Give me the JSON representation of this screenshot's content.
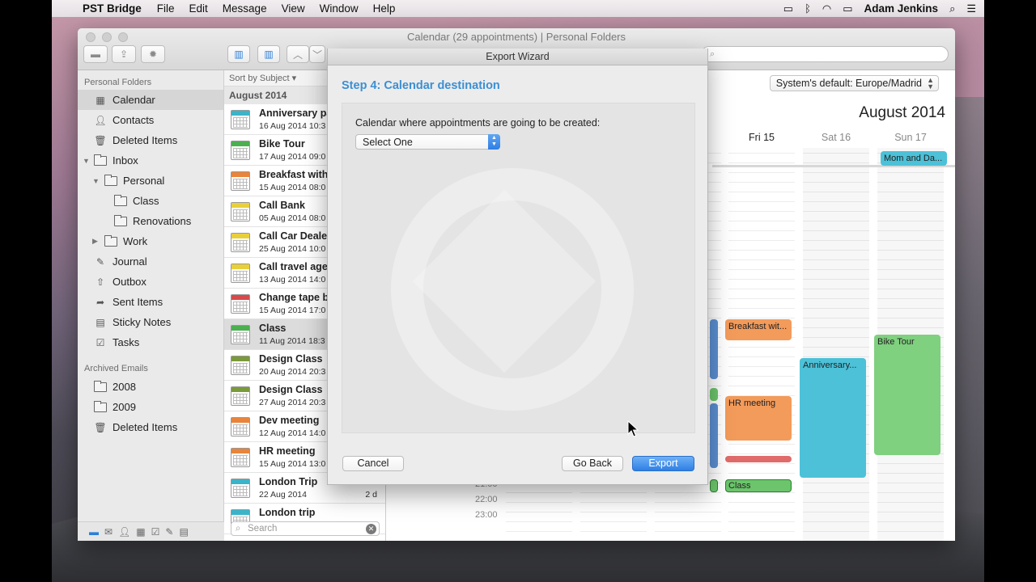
{
  "menubar": {
    "app_name": "PST Bridge",
    "items": [
      "File",
      "Edit",
      "Message",
      "View",
      "Window",
      "Help"
    ],
    "user": "Adam Jenkins"
  },
  "window": {
    "title": "Calendar (29 appointments) | Personal Folders",
    "search_placeholder": ""
  },
  "sidebar": {
    "section_personal": "Personal Folders",
    "items": [
      {
        "label": "Calendar",
        "icon": "calendar-icon"
      },
      {
        "label": "Contacts",
        "icon": "contacts-icon"
      },
      {
        "label": "Deleted Items",
        "icon": "trash-icon"
      },
      {
        "label": "Inbox",
        "icon": "folder-icon"
      },
      {
        "label": "Personal",
        "icon": "folder-icon"
      },
      {
        "label": "Class",
        "icon": "folder-icon"
      },
      {
        "label": "Renovations",
        "icon": "folder-icon"
      },
      {
        "label": "Work",
        "icon": "folder-icon"
      },
      {
        "label": "Journal",
        "icon": "journal-icon"
      },
      {
        "label": "Outbox",
        "icon": "outbox-icon"
      },
      {
        "label": "Sent Items",
        "icon": "sent-icon"
      },
      {
        "label": "Sticky Notes",
        "icon": "sticky-notes-icon"
      },
      {
        "label": "Tasks",
        "icon": "tasks-icon"
      }
    ],
    "section_archived": "Archived Emails",
    "archived": [
      {
        "label": "2008",
        "icon": "folder-icon"
      },
      {
        "label": "2009",
        "icon": "folder-icon"
      },
      {
        "label": "Deleted Items",
        "icon": "trash-icon"
      }
    ]
  },
  "list": {
    "sort_label": "Sort by Subject ▾",
    "group": "August 2014",
    "items": [
      {
        "title": "Anniversary pa",
        "date": "16 Aug 2014 10:3",
        "color": "#3bb4c9"
      },
      {
        "title": "Bike Tour",
        "date": "17 Aug 2014 09:0",
        "color": "#4caf50"
      },
      {
        "title": "Breakfast with",
        "date": "15 Aug 2014 08:0",
        "color": "#e8843b"
      },
      {
        "title": "Call Bank",
        "date": "05 Aug 2014 08:0",
        "color": "#e8d03b"
      },
      {
        "title": "Call Car Deale",
        "date": "25 Aug 2014 10:0",
        "color": "#e8d03b"
      },
      {
        "title": "Call travel age",
        "date": "13 Aug 2014 14:0",
        "color": "#e8d03b"
      },
      {
        "title": "Change tape b",
        "date": "15 Aug 2014 17:0",
        "color": "#d94a4a"
      },
      {
        "title": "Class",
        "date": "11 Aug 2014 18:3",
        "color": "#4caf50"
      },
      {
        "title": "Design Class",
        "date": "20 Aug 2014 20:3",
        "color": "#7a9a3b"
      },
      {
        "title": "Design Class",
        "date": "27 Aug 2014 20:3",
        "color": "#7a9a3b"
      },
      {
        "title": "Dev meeting",
        "date": "12 Aug 2014 14:0",
        "color": "#e8843b"
      },
      {
        "title": "HR meeting",
        "date": "15 Aug 2014 13:0",
        "color": "#e8843b"
      },
      {
        "title": "London Trip",
        "date": "22 Aug 2014",
        "color": "#3bb4c9",
        "duration": "2 d"
      },
      {
        "title": "London trip",
        "date": "",
        "color": "#3bb4c9"
      }
    ],
    "search_placeholder": "Search"
  },
  "calendar": {
    "timezone": "System's default: Europe/Madrid",
    "month_name": "August",
    "year": "2014",
    "days": [
      "Fri 15",
      "Sat 16",
      "Sun 17"
    ],
    "times": [
      "21:00",
      "22:00",
      "23:00"
    ],
    "events": {
      "mom_and_dad": "Mom and Da...",
      "breakfast": "Breakfast wit...",
      "hr_meeting": "HR meeting",
      "class": "Class",
      "anniversary": "Anniversary...",
      "bike_tour": "Bike Tour"
    }
  },
  "dialog": {
    "title": "Export Wizard",
    "step_title": "Step 4: Calendar destination",
    "field_label": "Calendar where appointments are going to be created:",
    "select_value": "Select One",
    "cancel": "Cancel",
    "go_back": "Go Back",
    "export": "Export"
  }
}
